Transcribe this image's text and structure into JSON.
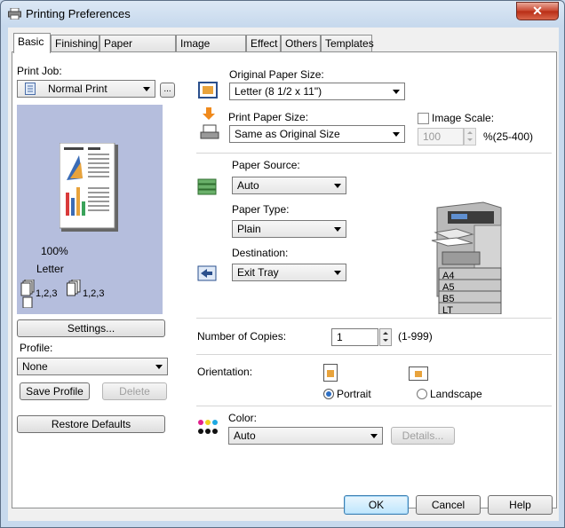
{
  "window": {
    "title": "Printing Preferences",
    "close_label": "✕"
  },
  "tabs": [
    "Basic",
    "Finishing",
    "Paper Handling",
    "Image Quality",
    "Effect",
    "Others",
    "Templates"
  ],
  "print_job": {
    "label": "Print Job:",
    "value": "Normal Print",
    "more_label": "..."
  },
  "preview": {
    "zoom": "100%",
    "paper": "Letter",
    "collate_a": "1,2,3",
    "collate_b": "1,2,3"
  },
  "left_buttons": {
    "settings": "Settings...",
    "profile_label": "Profile:",
    "profile_value": "None",
    "save_profile": "Save Profile",
    "delete": "Delete",
    "restore_defaults": "Restore Defaults"
  },
  "original_paper_size": {
    "label": "Original Paper Size:",
    "value": "Letter (8 1/2 x 11\")"
  },
  "print_paper_size": {
    "label": "Print Paper Size:",
    "value": "Same as Original Size"
  },
  "image_scale": {
    "label": "Image Scale:",
    "value": "100",
    "range": "%(25-400)",
    "checked": false
  },
  "paper_source": {
    "label": "Paper Source:",
    "value": "Auto"
  },
  "paper_type": {
    "label": "Paper Type:",
    "value": "Plain"
  },
  "destination": {
    "label": "Destination:",
    "value": "Exit Tray"
  },
  "trays": [
    "A4",
    "A5",
    "B5",
    "LT"
  ],
  "copies": {
    "label": "Number of Copies:",
    "value": "1",
    "range": "(1-999)"
  },
  "orientation": {
    "label": "Orientation:",
    "portrait": "Portrait",
    "landscape": "Landscape",
    "selected": "Portrait"
  },
  "color": {
    "label": "Color:",
    "value": "Auto",
    "details": "Details..."
  },
  "footer": {
    "ok": "OK",
    "cancel": "Cancel",
    "help": "Help"
  },
  "colors": {
    "accent": "#3c7fb1",
    "preview_bg": "#b5bedd",
    "close_red": "#c8452e"
  }
}
